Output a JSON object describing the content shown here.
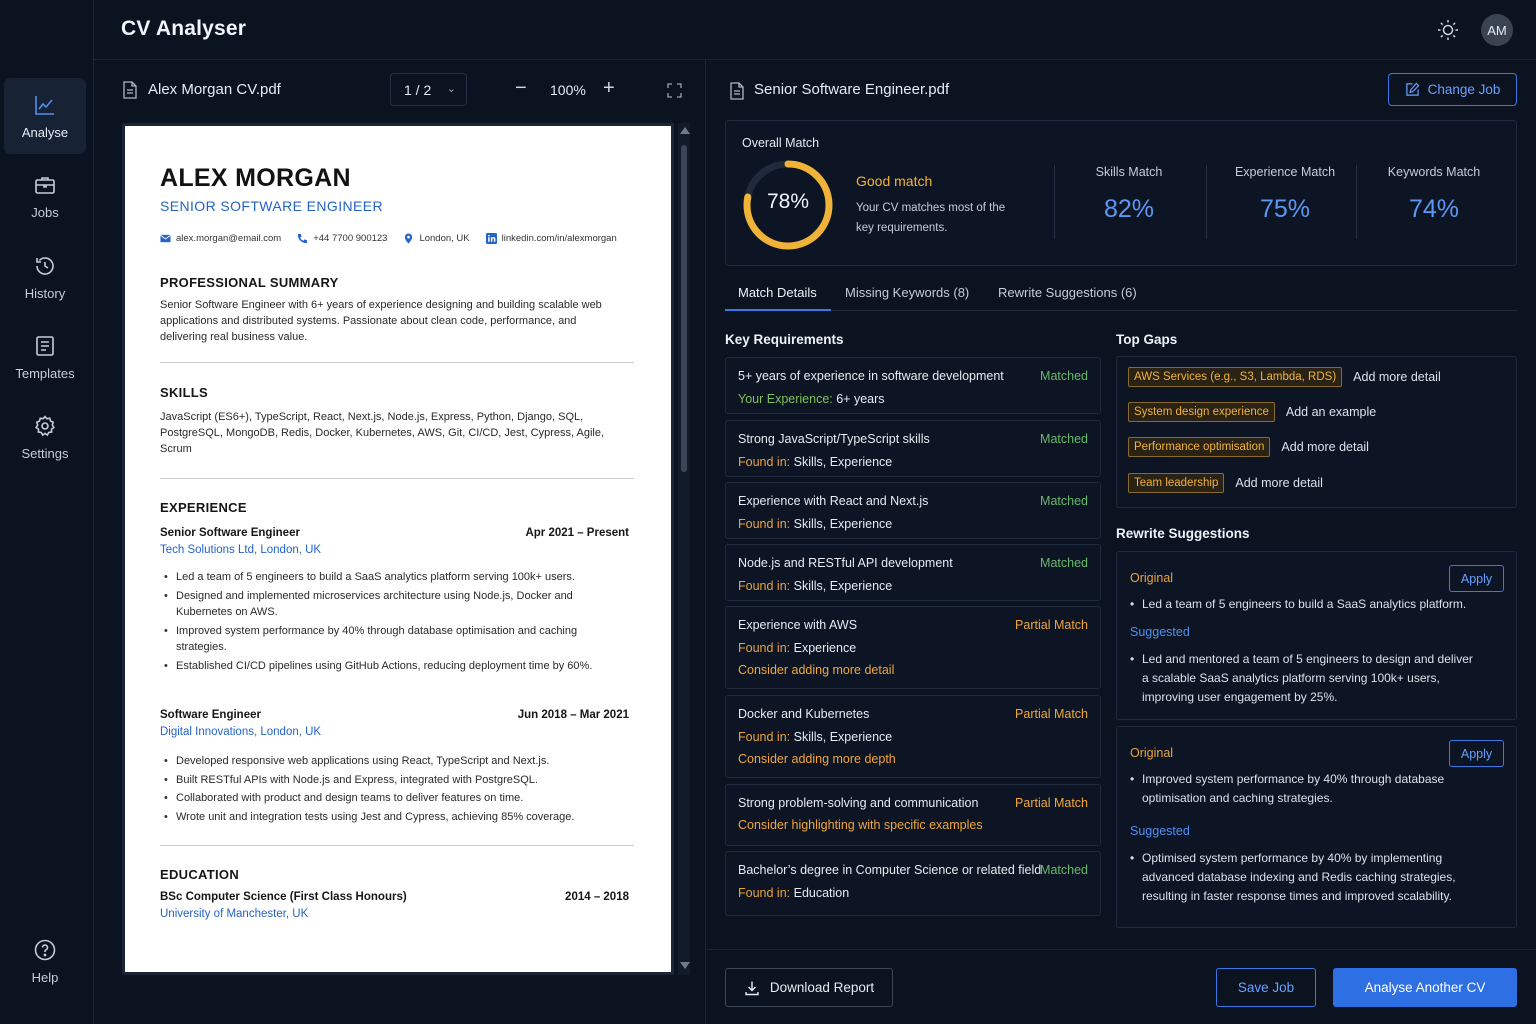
{
  "app": {
    "title": "CV Analyser",
    "avatar_initials": "AM"
  },
  "sidebar": {
    "items": [
      {
        "label": "Analyse",
        "icon": "chart-line-icon",
        "active": true
      },
      {
        "label": "Jobs",
        "icon": "briefcase-icon"
      },
      {
        "label": "History",
        "icon": "history-icon"
      },
      {
        "label": "Templates",
        "icon": "document-list-icon"
      },
      {
        "label": "Settings",
        "icon": "gear-icon"
      }
    ],
    "help": {
      "label": "Help",
      "icon": "help-circle-icon"
    }
  },
  "viewer": {
    "file_name": "Alex Morgan CV.pdf",
    "page_indicator": "1 / 2",
    "zoom": "100%"
  },
  "cv": {
    "name": "ALEX MORGAN",
    "role": "SENIOR SOFTWARE ENGINEER",
    "contacts": {
      "email": "alex.morgan@email.com",
      "phone": "+44 7700 900123",
      "location": "London, UK",
      "linkedin": "linkedin.com/in/alexmorgan"
    },
    "summary_heading": "PROFESSIONAL SUMMARY",
    "summary": "Senior Software Engineer with 6+ years of experience designing and building scalable web applications and distributed systems. Passionate about clean code, performance, and delivering real business value.",
    "skills_heading": "SKILLS",
    "skills": "JavaScript (ES6+), TypeScript, React, Next.js, Node.js, Express, Python, Django, SQL, PostgreSQL, MongoDB, Redis, Docker, Kubernetes, AWS, Git, CI/CD, Jest, Cypress, Agile, Scrum",
    "experience_heading": "EXPERIENCE",
    "jobs": [
      {
        "title": "Senior Software Engineer",
        "dates": "Apr 2021 – Present",
        "company": "Tech Solutions Ltd, London, UK",
        "bullets": [
          "Led a team of 5 engineers to build a SaaS analytics platform serving 100k+ users.",
          "Designed and implemented microservices architecture using Node.js, Docker and Kubernetes on AWS.",
          "Improved system performance by 40% through database optimisation and caching strategies.",
          "Established CI/CD pipelines using GitHub Actions, reducing deployment time by 60%."
        ]
      },
      {
        "title": "Software Engineer",
        "dates": "Jun 2018 – Mar 2021",
        "company": "Digital Innovations, London, UK",
        "bullets": [
          "Developed responsive web applications using React, TypeScript and Next.js.",
          "Built RESTful APIs with Node.js and Express, integrated with PostgreSQL.",
          "Collaborated with product and design teams to deliver features on time.",
          "Wrote unit and integration tests using Jest and Cypress, achieving 85% coverage."
        ]
      }
    ],
    "education_heading": "EDUCATION",
    "education": {
      "degree": "BSc Computer Science (First Class Honours)",
      "dates": "2014 – 2018",
      "school": "University of Manchester, UK"
    }
  },
  "job": {
    "file_name": "Senior Software Engineer.pdf",
    "change_label": "Change Job"
  },
  "match": {
    "overall_label": "Overall Match",
    "overall_value": "78%",
    "overall_fraction": 0.78,
    "verdict": "Good match",
    "description": "Your CV matches most of the key requirements.",
    "stats": [
      {
        "label": "Skills Match",
        "value": "82%"
      },
      {
        "label": "Experience Match",
        "value": "75%"
      },
      {
        "label": "Keywords Match",
        "value": "74%"
      }
    ],
    "ring_color": "#f0b33a",
    "accent_color": "#5b97f5"
  },
  "tabs": [
    "Match Details",
    "Missing Keywords (8)",
    "Rewrite Suggestions (6)"
  ],
  "requirements": {
    "title": "Key Requirements",
    "items": [
      {
        "title": "5+ years of experience in software development",
        "status": "Matched",
        "line1_label": "Your Experience:",
        "line1_value": "6+ years"
      },
      {
        "title": "Strong JavaScript/TypeScript skills",
        "status": "Matched",
        "line1_label": "Found in:",
        "line1_value": "Skills, Experience"
      },
      {
        "title": "Experience with React and Next.js",
        "status": "Matched",
        "line1_label": "Found in:",
        "line1_value": "Skills, Experience"
      },
      {
        "title": "Node.js and RESTful API development",
        "status": "Matched",
        "line1_label": "Found in:",
        "line1_value": "Skills, Experience"
      },
      {
        "title": "Experience with AWS",
        "status": "Partial Match",
        "line1_label": "Found in:",
        "line1_value": "Experience",
        "note": "Consider adding more detail"
      },
      {
        "title": "Docker and Kubernetes",
        "status": "Partial Match",
        "line1_label": "Found in:",
        "line1_value": "Skills, Experience",
        "note": "Consider adding more depth"
      },
      {
        "title": "Strong problem-solving and communication",
        "status": "Partial Match",
        "note": "Consider highlighting with specific examples"
      },
      {
        "title": "Bachelor’s degree in Computer Science or related field",
        "status": "Matched",
        "line1_label": "Found in:",
        "line1_value": "Education"
      }
    ]
  },
  "gaps": {
    "title": "Top Gaps",
    "items": [
      {
        "tag": "AWS Services (e.g., S3, Lambda, RDS)",
        "action": "Add more detail"
      },
      {
        "tag": "System design experience",
        "action": "Add an example"
      },
      {
        "tag": "Performance optimisation",
        "action": "Add more detail"
      },
      {
        "tag": "Team leadership",
        "action": "Add more detail"
      }
    ]
  },
  "rewrites": {
    "title": "Rewrite Suggestions",
    "original_label": "Original",
    "suggested_label": "Suggested",
    "apply_label": "Apply",
    "items": [
      {
        "original": "Led a team of 5 engineers to build a SaaS analytics platform.",
        "suggested": "Led and mentored a team of 5 engineers to design and deliver a scalable SaaS analytics platform serving 100k+ users, improving user engagement by 25%."
      },
      {
        "original": "Improved system performance by 40% through database optimisation and caching strategies.",
        "suggested": "Optimised system performance by 40% by implementing advanced database indexing and Redis caching strategies, resulting in faster response times and improved scalability."
      }
    ]
  },
  "footer": {
    "download_label": "Download Report",
    "save_label": "Save Job",
    "analyse_label": "Analyse Another CV"
  }
}
